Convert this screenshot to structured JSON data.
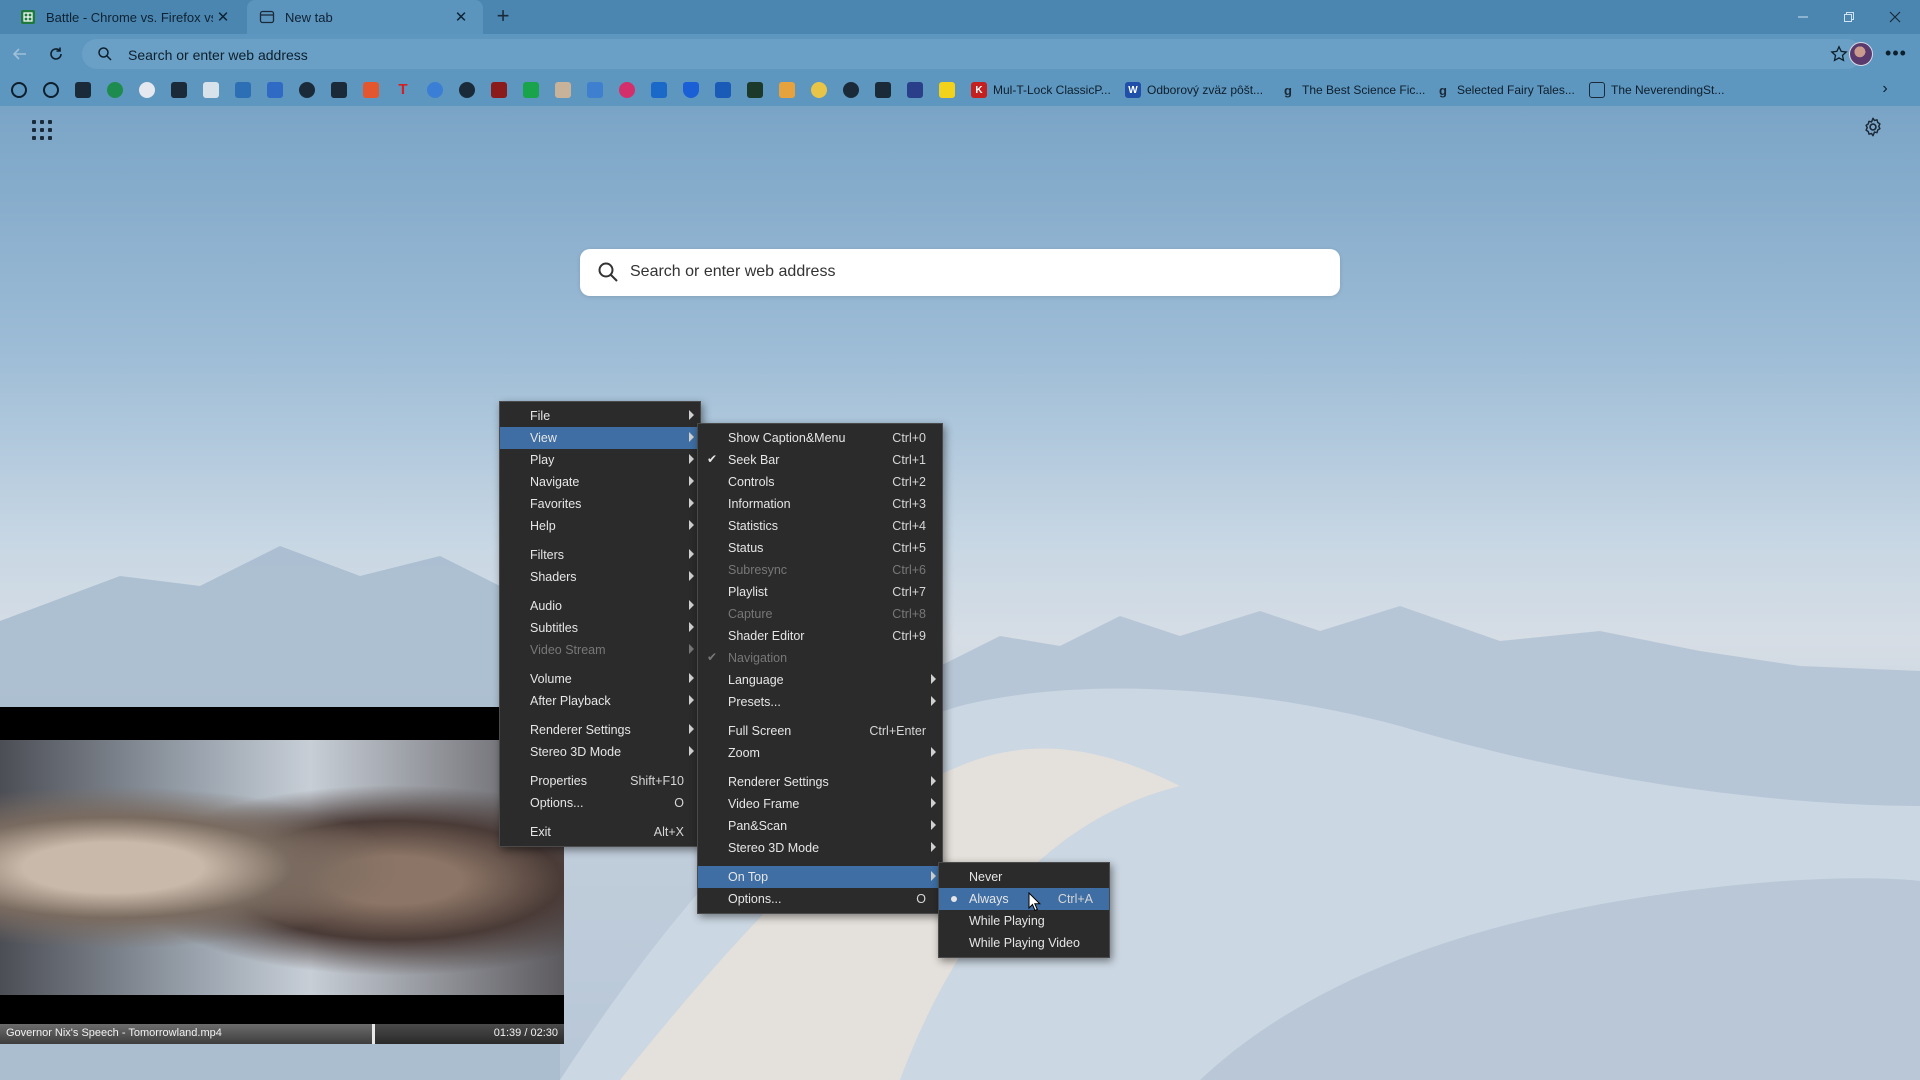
{
  "tabs": [
    {
      "title": "Battle - Chrome vs. Firefox vs. E",
      "icon": "sheets-icon"
    },
    {
      "title": "New tab",
      "icon": "newtab-icon"
    }
  ],
  "address_bar": {
    "placeholder": "Search or enter web address"
  },
  "bookmarks": [
    {
      "label": "Mul-T-Lock ClassicP..."
    },
    {
      "label": "Odborový zväz pôšt..."
    },
    {
      "label": "The Best Science Fic..."
    },
    {
      "label": "Selected Fairy Tales..."
    },
    {
      "label": "The NeverendingSt..."
    }
  ],
  "ntp": {
    "search_placeholder": "Search or enter web address"
  },
  "player": {
    "title": "Governor Nix's Speech - Tomorrowland.mp4",
    "time": "01:39 / 02:30",
    "progress": 0.66
  },
  "main_menu": [
    {
      "label": "File",
      "submenu": true
    },
    {
      "label": "View",
      "submenu": true,
      "highlighted": true
    },
    {
      "label": "Play",
      "submenu": true
    },
    {
      "label": "Navigate",
      "submenu": true
    },
    {
      "label": "Favorites",
      "submenu": true
    },
    {
      "label": "Help",
      "submenu": true
    },
    {
      "sep": true
    },
    {
      "label": "Filters",
      "submenu": true
    },
    {
      "label": "Shaders",
      "submenu": true
    },
    {
      "sep": true
    },
    {
      "label": "Audio",
      "submenu": true
    },
    {
      "label": "Subtitles",
      "submenu": true
    },
    {
      "label": "Video Stream",
      "submenu": true,
      "disabled": true
    },
    {
      "sep": true
    },
    {
      "label": "Volume",
      "submenu": true
    },
    {
      "label": "After Playback",
      "submenu": true
    },
    {
      "sep": true
    },
    {
      "label": "Renderer Settings",
      "submenu": true
    },
    {
      "label": "Stereo 3D Mode",
      "submenu": true
    },
    {
      "sep": true
    },
    {
      "label": "Properties",
      "shortcut": "Shift+F10"
    },
    {
      "label": "Options...",
      "shortcut": "O"
    },
    {
      "sep": true
    },
    {
      "label": "Exit",
      "shortcut": "Alt+X"
    }
  ],
  "view_menu": [
    {
      "label": "Show Caption&Menu",
      "shortcut": "Ctrl+0"
    },
    {
      "label": "Seek Bar",
      "shortcut": "Ctrl+1",
      "checked": true
    },
    {
      "label": "Controls",
      "shortcut": "Ctrl+2"
    },
    {
      "label": "Information",
      "shortcut": "Ctrl+3"
    },
    {
      "label": "Statistics",
      "shortcut": "Ctrl+4"
    },
    {
      "label": "Status",
      "shortcut": "Ctrl+5"
    },
    {
      "label": "Subresync",
      "shortcut": "Ctrl+6",
      "disabled": true
    },
    {
      "label": "Playlist",
      "shortcut": "Ctrl+7"
    },
    {
      "label": "Capture",
      "shortcut": "Ctrl+8",
      "disabled": true
    },
    {
      "label": "Shader Editor",
      "shortcut": "Ctrl+9"
    },
    {
      "label": "Navigation",
      "disabled": true,
      "checked": true
    },
    {
      "label": "Language",
      "submenu": true
    },
    {
      "label": "Presets...",
      "submenu": true
    },
    {
      "sep": true
    },
    {
      "label": "Full Screen",
      "shortcut": "Ctrl+Enter"
    },
    {
      "label": "Zoom",
      "submenu": true
    },
    {
      "sep": true
    },
    {
      "label": "Renderer Settings",
      "submenu": true
    },
    {
      "label": "Video Frame",
      "submenu": true
    },
    {
      "label": "Pan&Scan",
      "submenu": true
    },
    {
      "label": "Stereo 3D Mode",
      "submenu": true
    },
    {
      "sep": true
    },
    {
      "label": "On Top",
      "submenu": true,
      "highlighted": true
    },
    {
      "label": "Options...",
      "shortcut": "O"
    }
  ],
  "ontop_menu": [
    {
      "label": "Never"
    },
    {
      "label": "Always",
      "shortcut": "Ctrl+A",
      "highlighted": true,
      "radio": true
    },
    {
      "label": "While Playing"
    },
    {
      "label": "While Playing Video"
    }
  ]
}
